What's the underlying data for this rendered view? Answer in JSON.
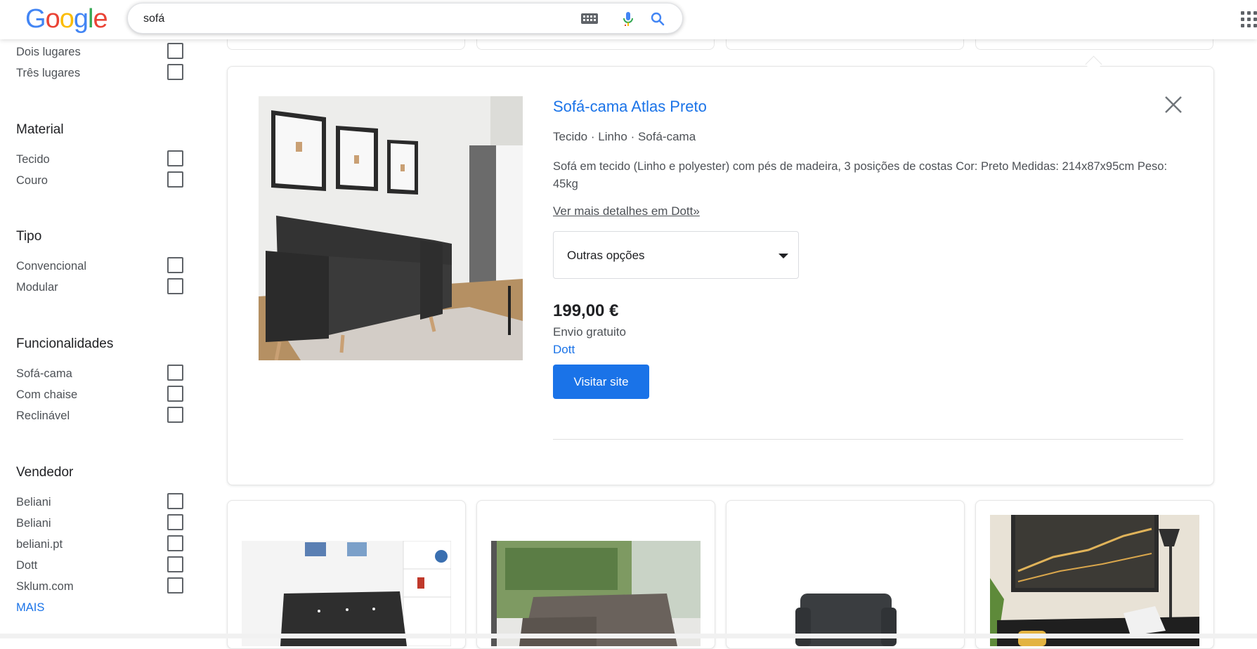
{
  "search": {
    "query": "sofá"
  },
  "colors": {
    "link": "#1a73e8",
    "button": "#1a73e8"
  },
  "sidebar": {
    "groups": [
      {
        "title": "",
        "items": [
          "Dois lugares",
          "Três lugares"
        ]
      },
      {
        "title": "Material",
        "items": [
          "Tecido",
          "Couro"
        ]
      },
      {
        "title": "Tipo",
        "items": [
          "Convencional",
          "Modular"
        ]
      },
      {
        "title": "Funcionalidades",
        "items": [
          "Sofá-cama",
          "Com chaise",
          "Reclinável"
        ]
      },
      {
        "title": "Vendedor",
        "items": [
          "Beliani",
          "Beliani",
          "beliani.pt",
          "Dott",
          "Sklum.com"
        ]
      }
    ],
    "more_label": "MAIS"
  },
  "product": {
    "title": "Sofá-cama Atlas Preto",
    "meta": "Tecido · Linho · Sofá-cama",
    "description": "Sofá em tecido (Linho e polyester) com pés de madeira, 3 posições de costas Cor: Preto Medidas: 214x87x95cm Peso: 45kg",
    "more_details": "Ver mais detalhes em Dott»",
    "options_label": "Outras opções",
    "price": "199,00 €",
    "shipping": "Envio gratuito",
    "seller": "Dott",
    "visit_label": "Visitar site"
  }
}
